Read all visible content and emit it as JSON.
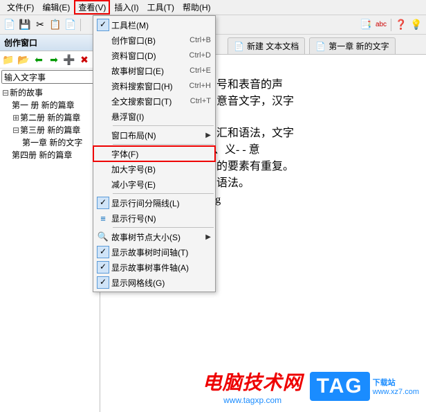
{
  "menubar": {
    "file": "文件(F)",
    "edit": "编辑(E)",
    "view": "查看(V)",
    "insert": "插入(I)",
    "tools": "工具(T)",
    "help": "帮助(H)"
  },
  "panel": {
    "title": "创作窗口",
    "search_value": "输入文字事"
  },
  "tree": {
    "root": "新的故事",
    "items": [
      "第一 册  新的篇章",
      "第二册  新的篇章",
      "第三册  新的篇章",
      "第一章  新的文字",
      "第四册  新的篇章"
    ]
  },
  "tabs": {
    "t1": "新建 文本文档",
    "t2": "第一章 新的文字"
  },
  "doc": {
    "l1": "文字是由表义的象形符号和表音的声",
    "l2": "是由表形文字进化成的意音文字，汉字",
    "l3": "的三要素是：语音、词汇和语法，文字",
    "l4": "- 语音、形- - 字符形状、义- - 意",
    "l5": "习它的文字，语言文字的要素有重复。",
    "l6": "：语音、字符、词汇、语法。",
    "l7": "w e n d a f a h g"
  },
  "menu": {
    "toolbar": "工具栏(M)",
    "creation_window": "创作窗口(B)",
    "material_window": "资料窗口(D)",
    "story_tree_window": "故事树窗口(E)",
    "material_search_window": "资料搜索窗口(H)",
    "fulltext_search_window": "全文搜索窗口(T)",
    "floating_window": "悬浮窗(I)",
    "window_layout": "窗口布局(N)",
    "font": "字体(F)",
    "increase_font": "加大字号(B)",
    "decrease_font": "减小字号(E)",
    "show_separator": "显示行间分隔线(L)",
    "show_line_no": "显示行号(N)",
    "story_node_size": "故事树节点大小(S)",
    "show_timeline": "显示故事树时间轴(T)",
    "show_event_axis": "显示故事树事件轴(A)",
    "show_grid": "显示网格线(G)",
    "sc_ctrl_b": "Ctrl+B",
    "sc_ctrl_d": "Ctrl+D",
    "sc_ctrl_e": "Ctrl+E",
    "sc_ctrl_h": "Ctrl+H",
    "sc_ctrl_t": "Ctrl+T"
  },
  "brand": {
    "b1_title": "电脑技术网",
    "b1_url": "www.tagxp.com",
    "b2_box": "TAG",
    "b2_label": "下载站",
    "b2_url": "www.xz7.com"
  }
}
